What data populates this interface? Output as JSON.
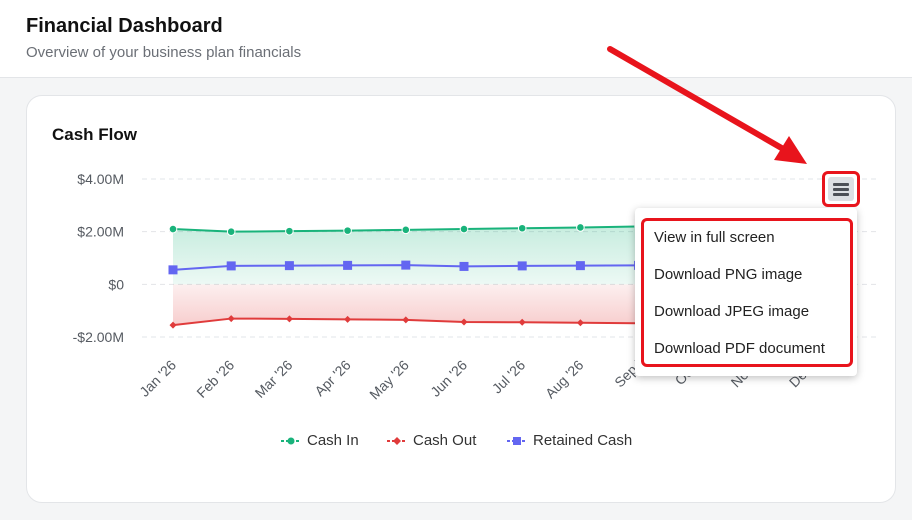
{
  "header": {
    "title": "Financial Dashboard",
    "subtitle": "Overview of your business plan financials"
  },
  "card": {
    "title": "Cash Flow"
  },
  "chart_data": {
    "type": "area",
    "categories": [
      "Jan '26",
      "Feb '26",
      "Mar '26",
      "Apr '26",
      "May '26",
      "Jun '26",
      "Jul '26",
      "Aug '26",
      "Sep '26",
      "Oct '26",
      "Nov '26",
      "Dec '26"
    ],
    "visible_x_labels": [
      "Jan '26",
      "Feb '26",
      "Mar '26",
      "Apr '26",
      "May '26",
      "Jun '26",
      "Jul '26",
      "Aug '26",
      "Sep '",
      "Oct '",
      "Nov '",
      "Dec '"
    ],
    "y_ticks": [
      4000000,
      2000000,
      0,
      -2000000
    ],
    "y_tick_labels": [
      "$4.00M",
      "$2.00M",
      "$0",
      "-$2.00M"
    ],
    "ylim": [
      -2000000,
      4000000
    ],
    "grid": true,
    "legend_position": "bottom",
    "series": [
      {
        "name": "Cash In",
        "color": "#19b37b",
        "marker": "circle",
        "values": [
          2100000,
          2000000,
          2020000,
          2040000,
          2070000,
          2100000,
          2130000,
          2160000,
          2200000,
          2230000,
          2260000,
          2290000
        ]
      },
      {
        "name": "Cash Out",
        "color": "#e03b3b",
        "marker": "diamond",
        "values": [
          -1550000,
          -1300000,
          -1310000,
          -1330000,
          -1350000,
          -1430000,
          -1440000,
          -1460000,
          -1480000,
          -1500000,
          -1520000,
          -1540000
        ]
      },
      {
        "name": "Retained Cash",
        "color": "#6366f1",
        "marker": "square",
        "values": [
          550000,
          700000,
          710000,
          720000,
          730000,
          680000,
          700000,
          710000,
          720000,
          730000,
          740000,
          750000
        ]
      }
    ]
  },
  "legend": [
    {
      "label": "Cash In",
      "color": "#19b37b",
      "marker": "circle"
    },
    {
      "label": "Cash Out",
      "color": "#e03b3b",
      "marker": "diamond"
    },
    {
      "label": "Retained Cash",
      "color": "#6366f1",
      "marker": "square"
    }
  ],
  "export_menu": {
    "button_icon": "hamburger-menu-icon",
    "items": [
      "View in full screen",
      "Download PNG image",
      "Download JPEG image",
      "Download PDF document"
    ]
  },
  "annotation": {
    "arrow_color": "#e8141c",
    "highlight_color": "#e8141c"
  }
}
